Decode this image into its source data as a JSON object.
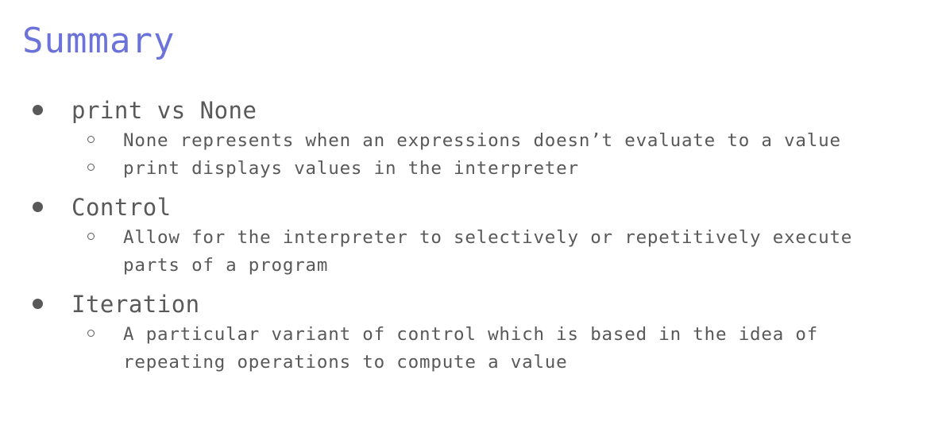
{
  "slide": {
    "title": "Summary",
    "accent_color": "#6b72d9",
    "text_color": "#595959",
    "bullets": [
      {
        "label": "print vs None",
        "sub_items": [
          "None represents when an expressions doesn’t evaluate to a value",
          "print displays values in the interpreter"
        ]
      },
      {
        "label": "Control",
        "sub_items": [
          "Allow for the interpreter to selectively or repetitively execute parts of a program"
        ]
      },
      {
        "label": "Iteration",
        "sub_items": [
          "A particular variant of control which is based in the idea of repeating operations to compute a value"
        ]
      }
    ]
  }
}
